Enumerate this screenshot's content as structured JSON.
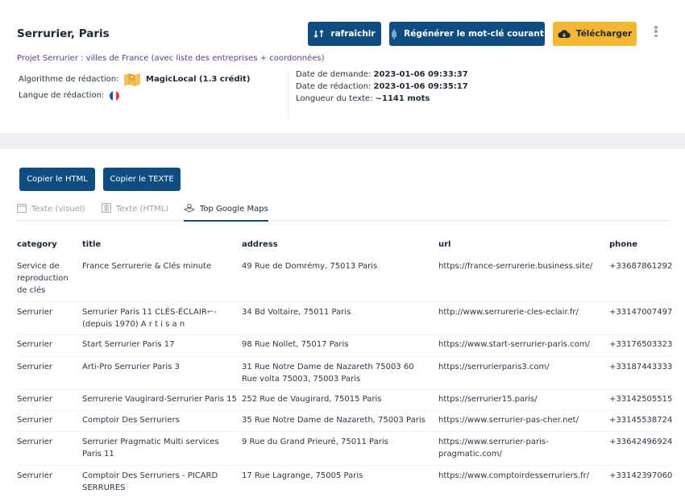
{
  "header": {
    "title": "Serrurier, Paris",
    "refresh_label": "rafraîchir",
    "regen_label": "Régénérer le mot-clé courant",
    "download_label": "Télécharger"
  },
  "project": {
    "label": "Projet Serrurier : villes de France (avec liste des entreprises + coordonnées)"
  },
  "meta": {
    "algo_label": "Algorithme de rédaction:",
    "algo_value": "MagicLocal (1.3 crédit)",
    "lang_label": "Langue de rédaction:",
    "demand_label": "Date de demande:",
    "demand_value": "2023-01-06 09:33:37",
    "write_label": "Date de rédaction:",
    "write_value": "2023-01-06 09:35:17",
    "length_label": "Longueur du texte:",
    "length_value": "~1141 mots"
  },
  "actions": {
    "copy_html": "Copier le HTML",
    "copy_text": "Copier le TEXTE"
  },
  "tabs": [
    {
      "label": "Texte (visuel)"
    },
    {
      "label": "Texte (HTML)"
    },
    {
      "label": "Top Google Maps"
    }
  ],
  "table": {
    "headers": [
      "category",
      "title",
      "address",
      "url",
      "phone"
    ],
    "rows": [
      {
        "category": "Service de reproduction de clés",
        "title": "France Serrurerie & Clés minute",
        "address": "49 Rue de Domrémy, 75013 Paris",
        "url": "https://france-serrurerie.business.site/",
        "phone": "+33687861292"
      },
      {
        "category": "Serrurier",
        "title": "Serrurier Paris 11 CLÉS-ÉCLAIR⌐- (depuis 1970) A r t i s a n",
        "address": "34 Bd Voltaire, 75011 Paris",
        "url": "http://www.serrurerie-cles-eclair.fr/",
        "phone": "+33147007497"
      },
      {
        "category": "Serrurier",
        "title": "Start Serrurier Paris 17",
        "address": "98 Rue Nollet, 75017 Paris",
        "url": "https://www.start-serrurier-paris.com/",
        "phone": "+33176503323"
      },
      {
        "category": "Serrurier",
        "title": "Arti-Pro Serrurier Paris 3",
        "address": "31 Rue Notre Dame de Nazareth 75003 60 Rue volta 75003, 75003 Paris",
        "url": "https://serrurierparis3.com/",
        "phone": "+33187443333"
      },
      {
        "category": "Serrurier",
        "title": "Serrurerie Vaugirard-Serrurier Paris 15",
        "address": "252 Rue de Vaugirard, 75015 Paris",
        "url": "https://serrurier15.paris/",
        "phone": "+33142505515"
      },
      {
        "category": "Serrurier",
        "title": "Comptoir Des Serruriers",
        "address": "35 Rue Notre Dame de Nazareth, 75003 Paris",
        "url": "https://www.serrurier-pas-cher.net/",
        "phone": "+33145538724"
      },
      {
        "category": "Serrurier",
        "title": "Serrurier Pragmatic Multi services Paris 11",
        "address": "9 Rue du Grand Prieuré, 75011 Paris",
        "url": "https://www.serrurier-paris-pragmatic.com/",
        "phone": "+33642496924"
      },
      {
        "category": "Serrurier",
        "title": "Comptoir Des Serruriers - PICARD SERRURES",
        "address": "17 Rue Lagrange, 75005 Paris",
        "url": "https://www.comptoirdesserruriers.fr/",
        "phone": "+33142397060"
      }
    ]
  }
}
